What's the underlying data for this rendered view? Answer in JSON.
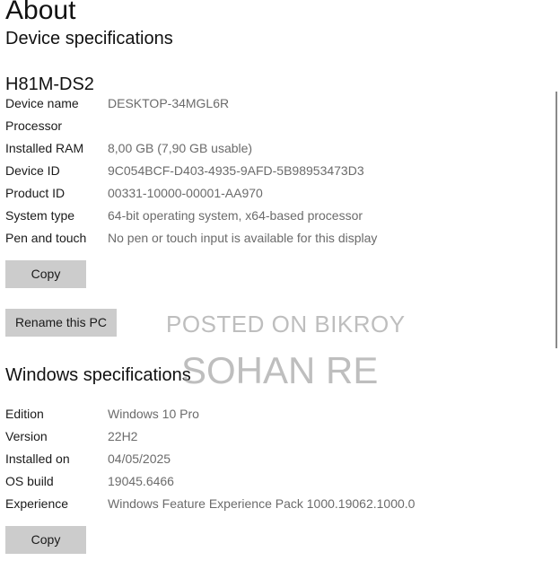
{
  "page_title": "About",
  "device_specs": {
    "section_title": "Device specifications",
    "device_model": "H81M-DS2",
    "rows": [
      {
        "label": "Device name",
        "value": "DESKTOP-34MGL6R"
      },
      {
        "label": "Processor",
        "value": ""
      },
      {
        "label": "Installed RAM",
        "value": "8,00 GB (7,90 GB usable)"
      },
      {
        "label": "Device ID",
        "value": "9C054BCF-D403-4935-9AFD-5B98953473D3"
      },
      {
        "label": "Product ID",
        "value": "00331-10000-00001-AA970"
      },
      {
        "label": "System type",
        "value": "64-bit operating system, x64-based processor"
      },
      {
        "label": "Pen and touch",
        "value": "No pen or touch input is available for this display"
      }
    ],
    "copy_label": "Copy",
    "rename_label": "Rename this PC"
  },
  "windows_specs": {
    "section_title": "Windows specifications",
    "rows": [
      {
        "label": "Edition",
        "value": "Windows 10 Pro"
      },
      {
        "label": "Version",
        "value": "22H2"
      },
      {
        "label": "Installed on",
        "value": "04/05/2025"
      },
      {
        "label": "OS build",
        "value": "19045.6466"
      },
      {
        "label": "Experience",
        "value": "Windows Feature Experience Pack 1000.19062.1000.0"
      }
    ],
    "copy_label": "Copy"
  },
  "watermark": {
    "line1": "POSTED ON BIKROY",
    "line2": "SOHAN RE"
  },
  "colors": {
    "button_bg": "#cccccc",
    "value_text": "#6b6b6b",
    "label_text": "#1a1a1a"
  }
}
